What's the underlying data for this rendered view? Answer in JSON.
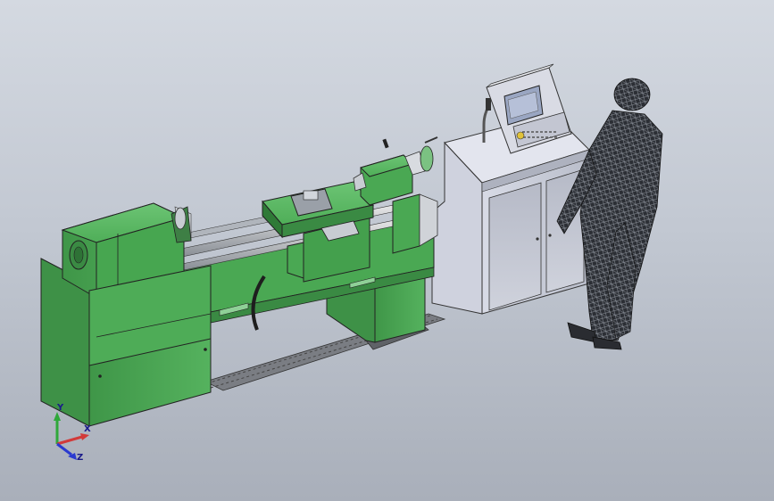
{
  "viewport": {
    "background_top": "#d4d9e1",
    "background_bottom": "#a9afba"
  },
  "model": {
    "body_color": "#4fae58",
    "body_shadow": "#3a8a43",
    "cabinet_color": "#c9ccd8",
    "screen_color": "#9aa6c2",
    "chain_color": "#6b6b6b",
    "figure_color": "#3c3f46"
  },
  "triad": {
    "x_label": "X",
    "y_label": "Y",
    "z_label": "Z",
    "x_color": "#d23a3a",
    "y_color": "#2fa83a",
    "z_color": "#2a3ad0"
  }
}
